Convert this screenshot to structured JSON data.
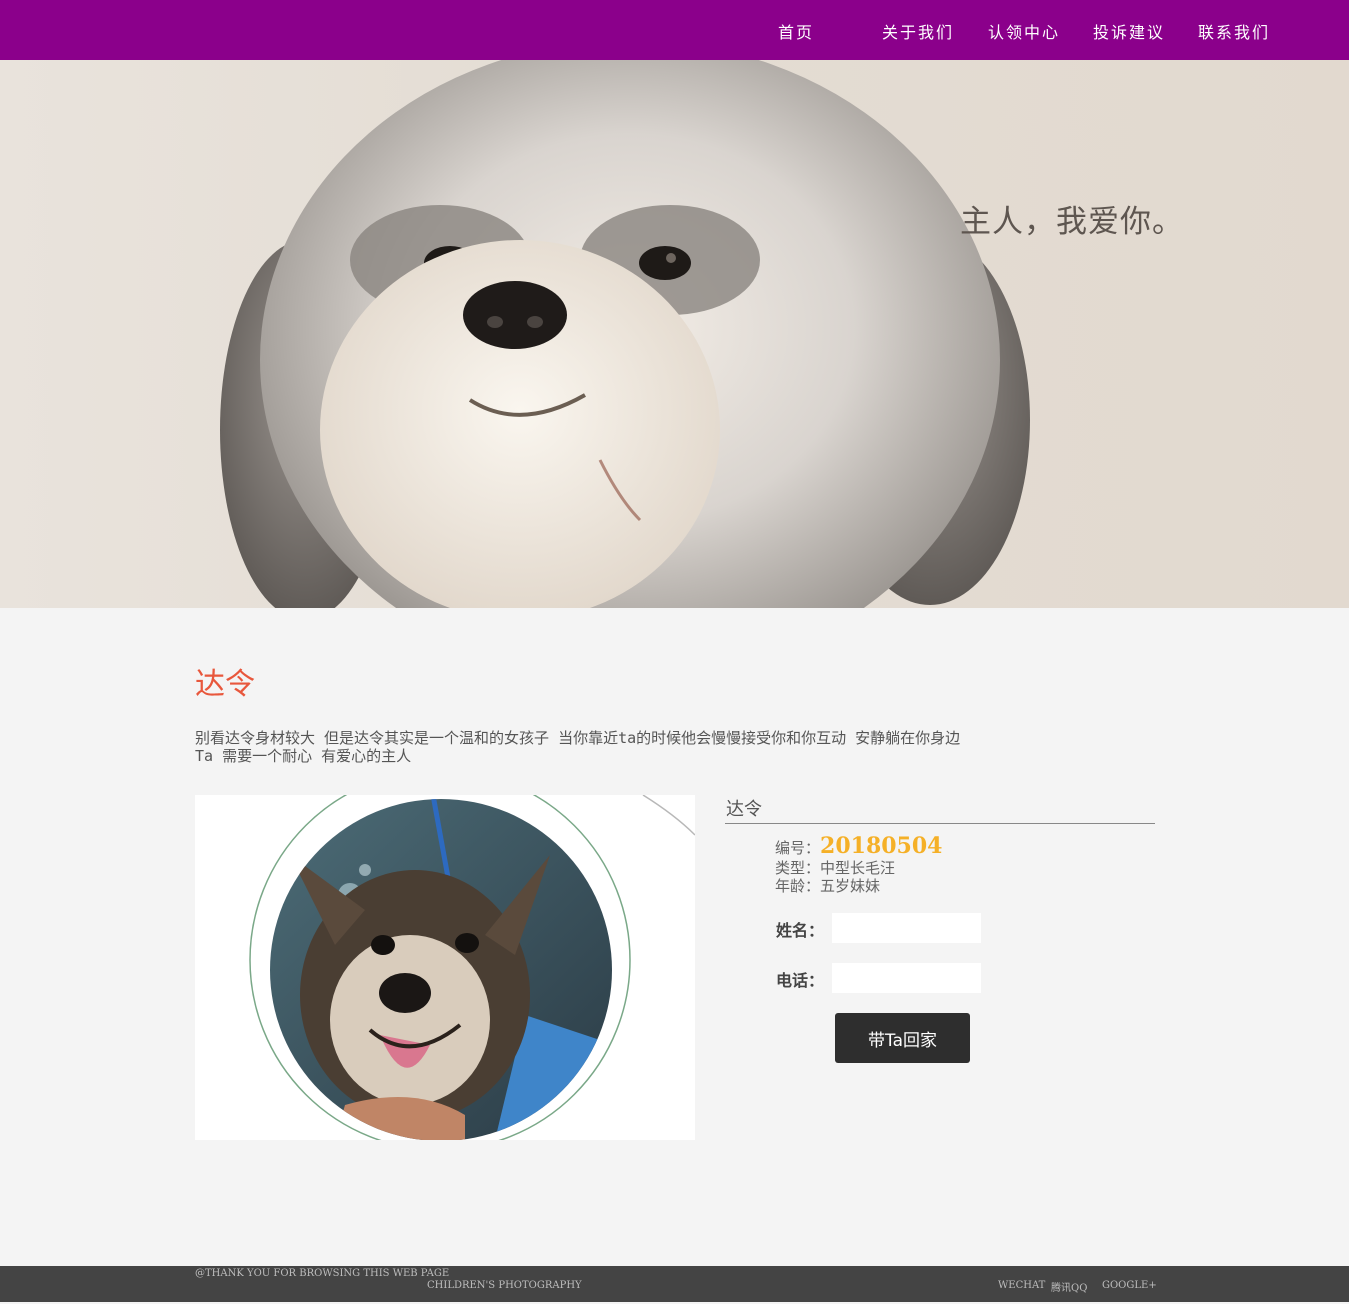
{
  "nav": {
    "items": [
      {
        "label": "首页"
      },
      {
        "label": "关于我们"
      },
      {
        "label": "认领中心"
      },
      {
        "label": "投诉建议"
      },
      {
        "label": "联系我们"
      }
    ],
    "bar_color": "#8b008b"
  },
  "hero": {
    "caption": "主人，我爱你。"
  },
  "pet": {
    "name": "达令",
    "description_line1": "别看达令身材较大 但是达令其实是一个温和的女孩子 当你靠近ta的时候他会慢慢接受你和你互动 安静躺在你身边",
    "description_line2": "Ta 需要一个耐心 有爱心的主人",
    "name_color": "#e8573c"
  },
  "info": {
    "title": "达令",
    "id_label": "编号：",
    "id_value": "20180504",
    "type_label": "类型：",
    "type_value": "中型长毛汪",
    "age_label": "年龄：",
    "age_value": "五岁妹妹",
    "id_color": "#f5b027"
  },
  "form": {
    "name_label": "姓名：",
    "name_value": "",
    "phone_label": "电话：",
    "phone_value": "",
    "submit_label": "带Ta回家"
  },
  "footer": {
    "thanks": "@THANK YOU FOR BROWSING THIS WEB PAGE",
    "brand": "CHILDREN'S PHOTOGRAPHY",
    "links": [
      {
        "label": "WECHAT"
      },
      {
        "label": "腾讯QQ"
      },
      {
        "label": "GOOGLE+"
      }
    ]
  }
}
